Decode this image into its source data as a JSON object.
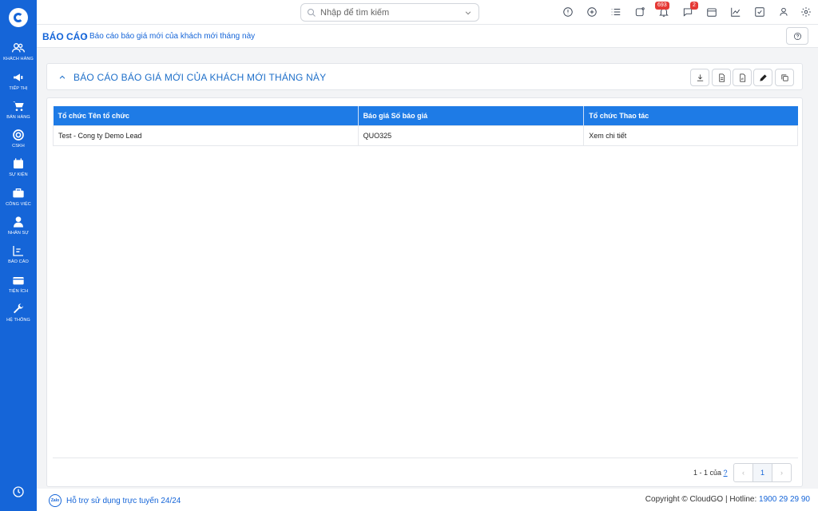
{
  "sidebar": {
    "items": [
      {
        "label": "KHÁCH HÀNG",
        "icon": "users-icon"
      },
      {
        "label": "TIẾP THỊ",
        "icon": "megaphone-icon"
      },
      {
        "label": "BÁN HÀNG",
        "icon": "cart-icon"
      },
      {
        "label": "CSKH",
        "icon": "support-icon"
      },
      {
        "label": "SỰ KIỆN",
        "icon": "calendar-icon"
      },
      {
        "label": "CÔNG VIỆC",
        "icon": "briefcase-icon"
      },
      {
        "label": "NHÂN SỰ",
        "icon": "person-icon"
      },
      {
        "label": "BÁO CÁO",
        "icon": "chart-icon"
      },
      {
        "label": "TIỆN ÍCH",
        "icon": "box-icon"
      },
      {
        "label": "HỆ THỐNG",
        "icon": "wrench-icon"
      }
    ]
  },
  "search": {
    "placeholder": "Nhập để tìm kiếm"
  },
  "notifications": {
    "count": "693"
  },
  "messages": {
    "count": "2"
  },
  "breadcrumb": {
    "main": "BÁO CÁO",
    "separator": "›",
    "sub": "Báo cáo báo giá mới của khách mới tháng này"
  },
  "report": {
    "title": "BÁO CÁO BÁO GIÁ MỚI CỦA KHÁCH MỚI THÁNG NÀY"
  },
  "table": {
    "headers": [
      "Tổ chức Tên tổ chức",
      "Báo giá Số báo giá",
      "Tổ chức Thao tác"
    ],
    "rows": [
      [
        "Test - Cong ty Demo Lead",
        "QUO325",
        "Xem chi tiết"
      ]
    ]
  },
  "pagination": {
    "summary": "1 - 1 của",
    "help": "?",
    "prev": "‹",
    "current": "1",
    "next": "›"
  },
  "footer": {
    "support": "Hỗ trợ sử dụng trực tuyến 24/24",
    "zalo": "Zalo",
    "copyright": "Copyright © CloudGO | Hotline:",
    "hotline": "1900 29 29 90"
  },
  "colors": {
    "primary": "#1565d8",
    "header": "#1e7be6",
    "badge": "#e53935"
  }
}
